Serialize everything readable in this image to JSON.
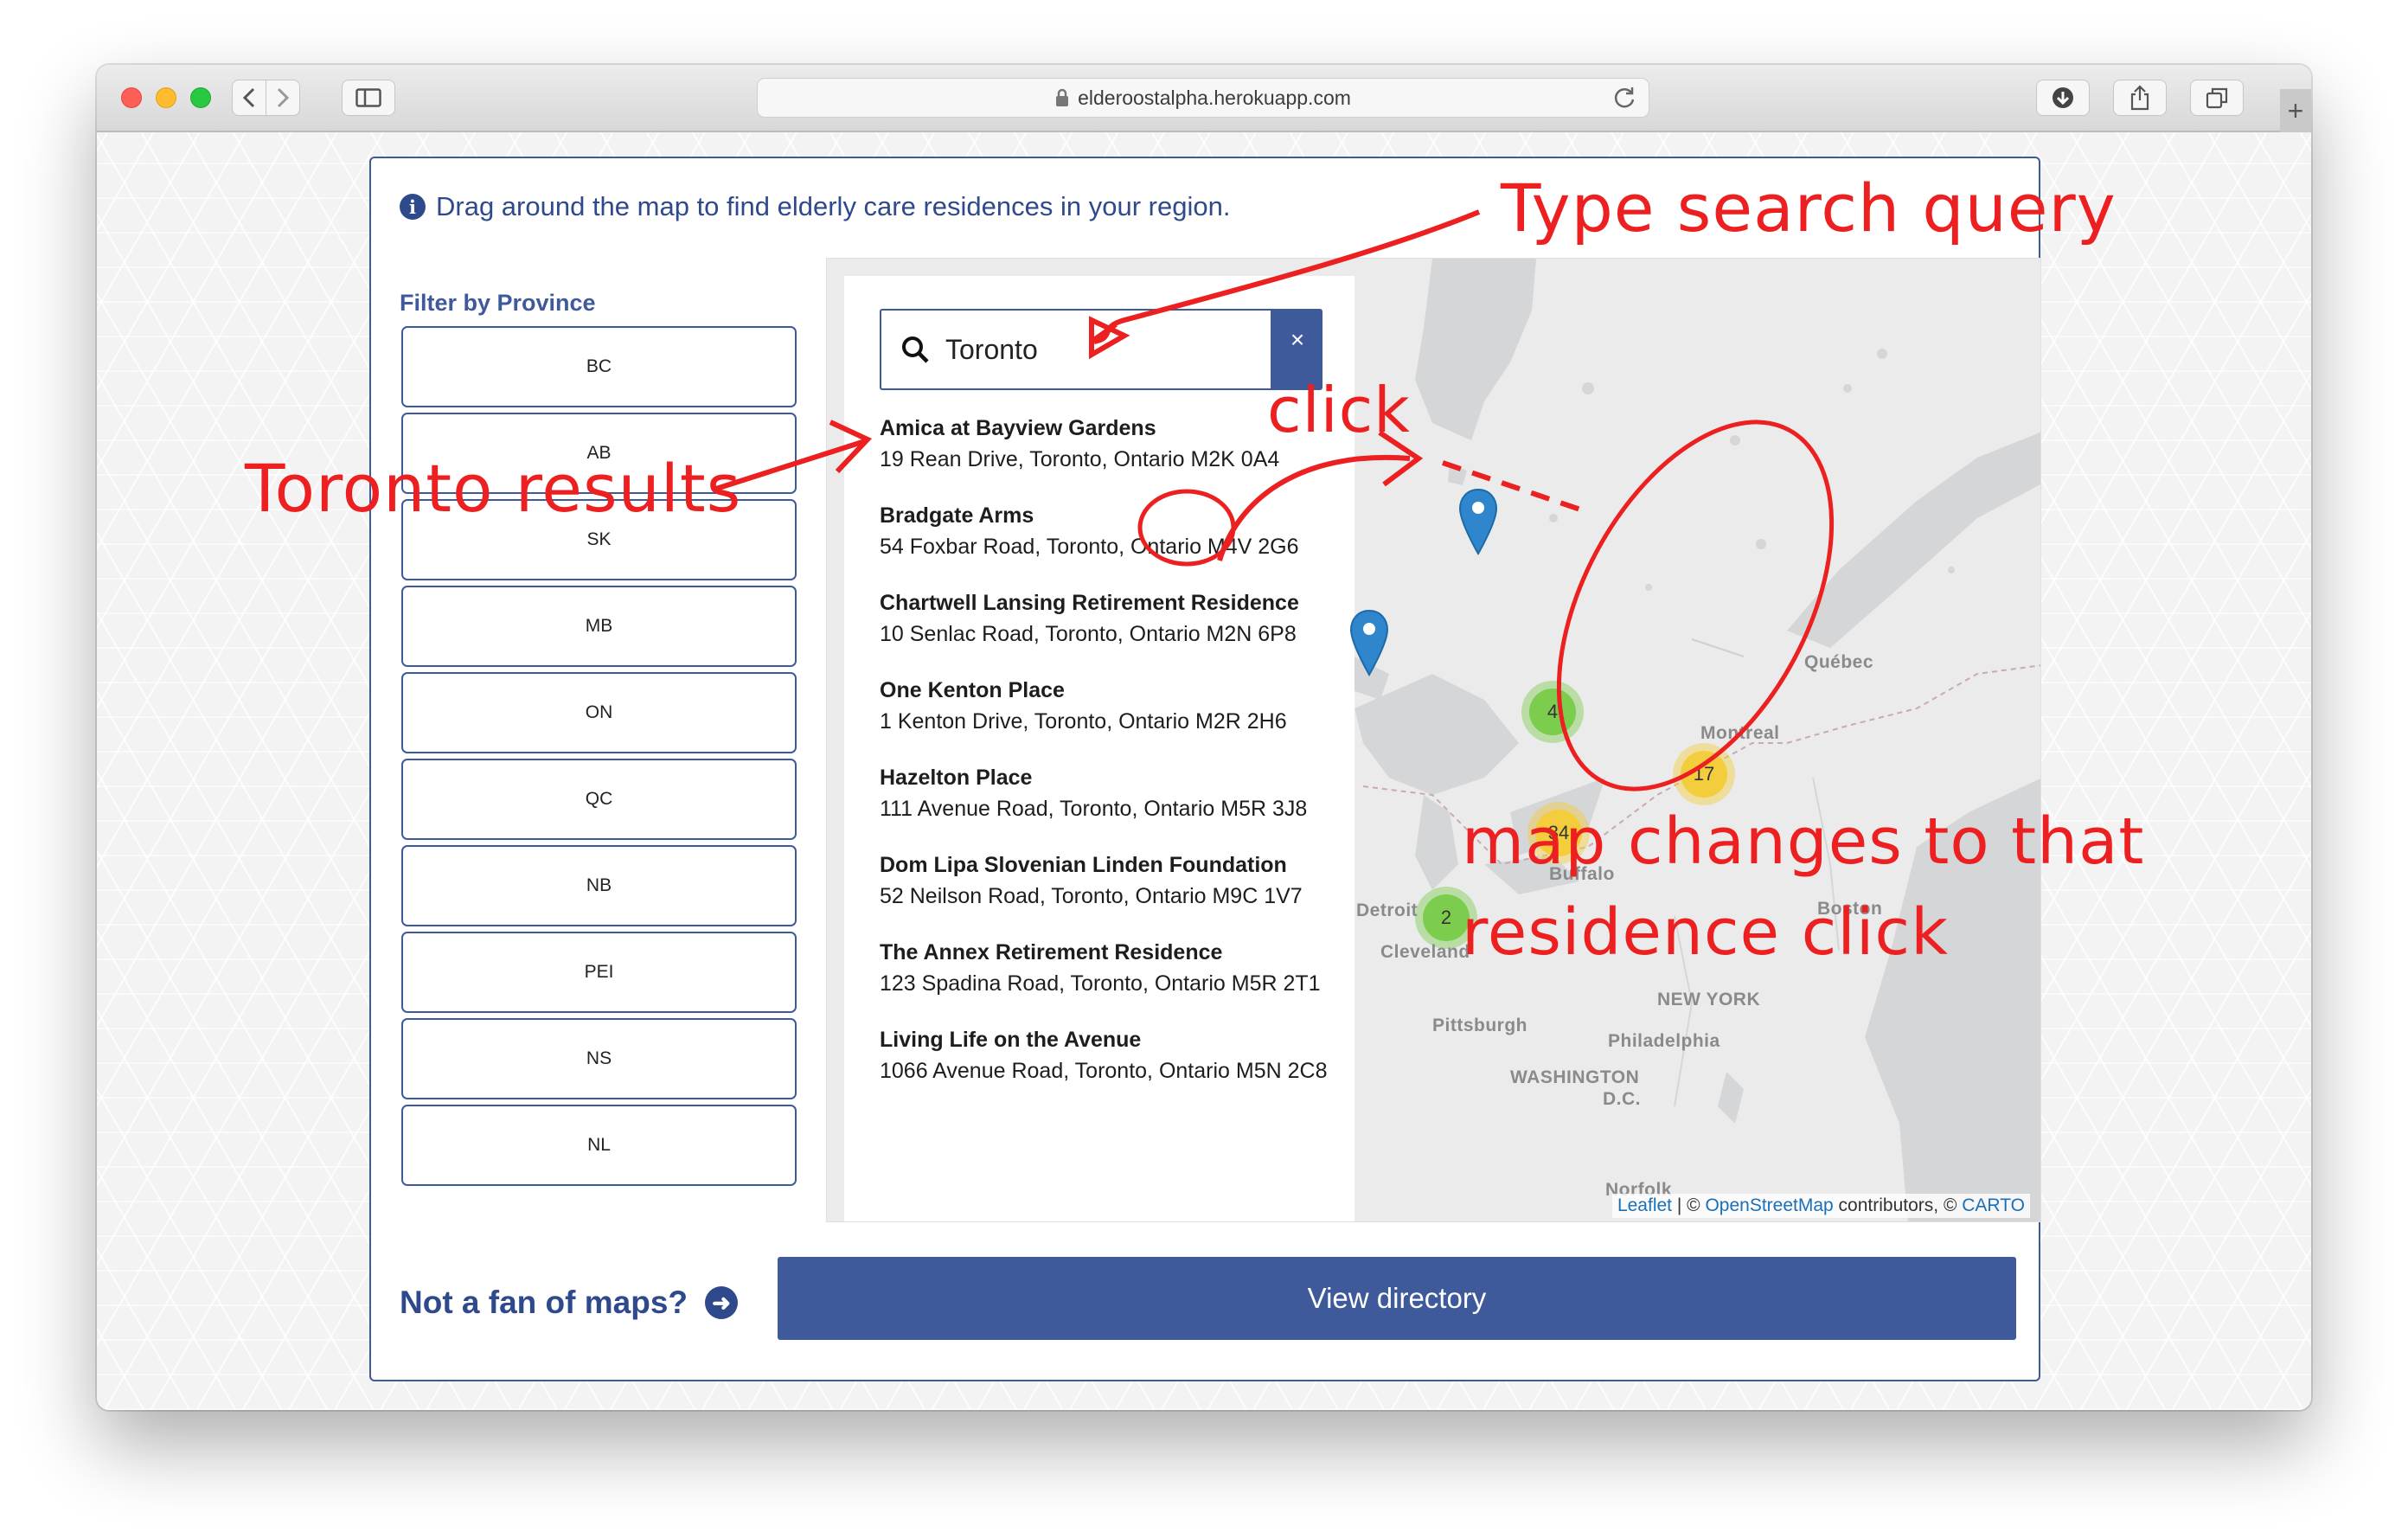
{
  "browser": {
    "url": "elderoostalpha.herokuapp.com"
  },
  "page": {
    "info_text": "Drag around the map to find elderly care residences in your region.",
    "filter_title": "Filter by Province",
    "provinces": [
      "BC",
      "AB",
      "SK",
      "MB",
      "ON",
      "QC",
      "NB",
      "PEI",
      "NS",
      "NL"
    ],
    "search": {
      "value": "Toronto",
      "clear_label": "×"
    },
    "results": [
      {
        "name": "Amica at Bayview Gardens",
        "address": "19 Rean Drive, Toronto, Ontario M2K 0A4"
      },
      {
        "name": "Bradgate Arms",
        "address": "54 Foxbar Road, Toronto, Ontario M4V 2G6"
      },
      {
        "name": "Chartwell Lansing Retirement Residence",
        "address": "10 Senlac Road, Toronto, Ontario M2N 6P8"
      },
      {
        "name": "One Kenton Place",
        "address": "1 Kenton Drive, Toronto, Ontario M2R 2H6"
      },
      {
        "name": "Hazelton Place",
        "address": "111 Avenue Road, Toronto, Ontario M5R 3J8"
      },
      {
        "name": "Dom Lipa Slovenian Linden Foundation",
        "address": "52 Neilson Road, Toronto, Ontario M9C 1V7"
      },
      {
        "name": "The Annex Retirement Residence",
        "address": "123 Spadina Road, Toronto, Ontario M5R 2T1"
      },
      {
        "name": "Living Life on the Avenue",
        "address": "1066 Avenue Road, Toronto, Ontario M5N 2C8"
      }
    ],
    "map": {
      "clusters": [
        {
          "count": "4",
          "color": "#7ccc4e"
        },
        {
          "count": "17",
          "color": "#f4cd3c"
        },
        {
          "count": "34",
          "color": "#f4cd3c"
        },
        {
          "count": "2",
          "color": "#7ccc4e"
        }
      ],
      "cities": [
        "Québec",
        "Montreal",
        "Buffalo",
        "Detroit",
        "Cleveland",
        "Boston",
        "NEW YORK",
        "Pittsburgh",
        "Philadelphia",
        "WASHINGTON",
        "D.C.",
        "Norfolk"
      ],
      "attribution": {
        "leaflet": "Leaflet",
        "sep": " | © ",
        "osm": "OpenStreetMap",
        "mid": " contributors, © ",
        "carto": "CARTO"
      }
    },
    "footer": {
      "fan_text": "Not a fan of maps?",
      "view_button": "View directory"
    }
  },
  "annotations": {
    "type_search": "Type search query",
    "toronto_results": "Toronto results",
    "click": "click",
    "map_changes_1": "map changes to that",
    "map_changes_2": "residence click"
  },
  "colors": {
    "brand": "#3f5a9a",
    "annotation": "#ec2020"
  }
}
